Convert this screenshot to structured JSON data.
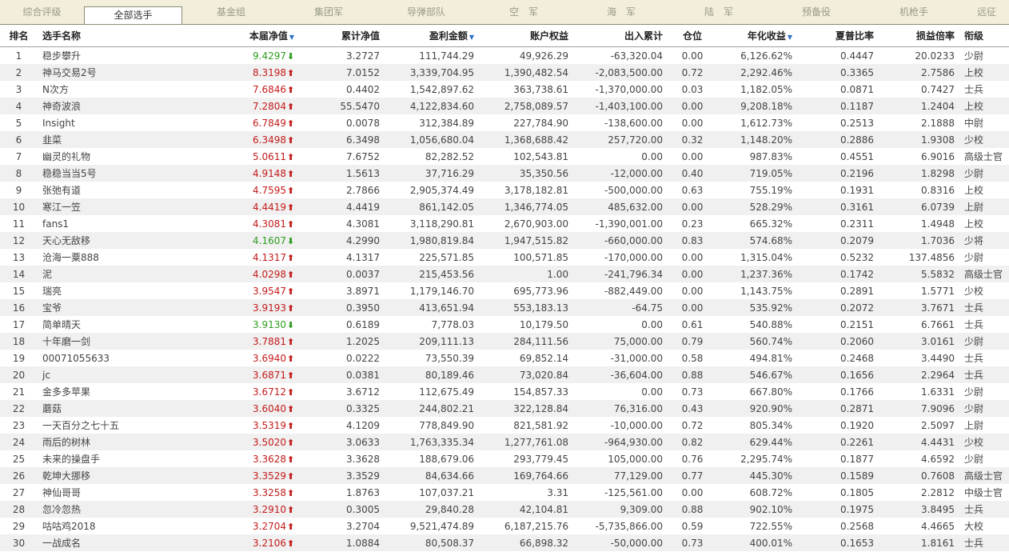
{
  "tabs": [
    "综合评级",
    "全部选手",
    "基金组",
    "集团军",
    "导弹部队",
    "空　军",
    "海　军",
    "陆　军",
    "预备役",
    "机枪手",
    "远征"
  ],
  "active_tab": 1,
  "sort_indicator": "▼",
  "colors": {
    "up": "#c41b1b",
    "down": "#2e9c1f",
    "sort": "#2a6fc9",
    "tab_bar": "#f2eedb",
    "row_alt": "#f0f0f0"
  },
  "icons": {
    "up": "up-arrow-icon",
    "down": "down-arrow-icon"
  },
  "columns": [
    {
      "key": "rank",
      "label": "排名",
      "align": "c"
    },
    {
      "key": "name",
      "label": "选手名称",
      "align": "l"
    },
    {
      "key": "nav",
      "label": "本届净值",
      "align": "r",
      "sorted": true
    },
    {
      "key": "cum",
      "label": "累计净值",
      "align": "r"
    },
    {
      "key": "profit",
      "label": "盈利金额",
      "align": "r",
      "sorted": true
    },
    {
      "key": "equity",
      "label": "账户权益",
      "align": "r"
    },
    {
      "key": "flow",
      "label": "出入累计",
      "align": "r"
    },
    {
      "key": "pos",
      "label": "仓位",
      "align": "c"
    },
    {
      "key": "annual",
      "label": "年化收益",
      "align": "r",
      "sorted": true
    },
    {
      "key": "sharpe",
      "label": "夏普比率",
      "align": "r"
    },
    {
      "key": "ratio",
      "label": "损益倍率",
      "align": "r"
    },
    {
      "key": "rank_title",
      "label": "衔级",
      "align": "l"
    }
  ],
  "rows": [
    {
      "rank": "1",
      "name": "稳步攀升",
      "nav": "9.4297",
      "dir": "down",
      "cum": "3.2727",
      "profit": "111,744.29",
      "equity": "49,926.29",
      "flow": "-63,320.04",
      "pos": "0.00",
      "annual": "6,126.62%",
      "sharpe": "0.4447",
      "ratio": "20.0233",
      "rank_title": "少尉"
    },
    {
      "rank": "2",
      "name": "神马交易2号",
      "nav": "8.3198",
      "dir": "up",
      "cum": "7.0152",
      "profit": "3,339,704.95",
      "equity": "1,390,482.54",
      "flow": "-2,083,500.00",
      "pos": "0.72",
      "annual": "2,292.46%",
      "sharpe": "0.3365",
      "ratio": "2.7586",
      "rank_title": "上校"
    },
    {
      "rank": "3",
      "name": "N次方",
      "nav": "7.6846",
      "dir": "up",
      "cum": "0.4402",
      "profit": "1,542,897.62",
      "equity": "363,738.61",
      "flow": "-1,370,000.00",
      "pos": "0.03",
      "annual": "1,182.05%",
      "sharpe": "0.0871",
      "ratio": "0.7427",
      "rank_title": "士兵"
    },
    {
      "rank": "4",
      "name": "神奇波浪",
      "nav": "7.2804",
      "dir": "up",
      "cum": "55.5470",
      "profit": "4,122,834.60",
      "equity": "2,758,089.57",
      "flow": "-1,403,100.00",
      "pos": "0.00",
      "annual": "9,208.18%",
      "sharpe": "0.1187",
      "ratio": "1.2404",
      "rank_title": "上校"
    },
    {
      "rank": "5",
      "name": "Insight",
      "nav": "6.7849",
      "dir": "up",
      "cum": "0.0078",
      "profit": "312,384.89",
      "equity": "227,784.90",
      "flow": "-138,600.00",
      "pos": "0.00",
      "annual": "1,612.73%",
      "sharpe": "0.2513",
      "ratio": "2.1888",
      "rank_title": "中尉"
    },
    {
      "rank": "6",
      "name": "韭菜",
      "nav": "6.3498",
      "dir": "up",
      "cum": "6.3498",
      "profit": "1,056,680.04",
      "equity": "1,368,688.42",
      "flow": "257,720.00",
      "pos": "0.32",
      "annual": "1,148.20%",
      "sharpe": "0.2886",
      "ratio": "1.9308",
      "rank_title": "少校"
    },
    {
      "rank": "7",
      "name": "幽灵的礼物",
      "nav": "5.0611",
      "dir": "up",
      "cum": "7.6752",
      "profit": "82,282.52",
      "equity": "102,543.81",
      "flow": "0.00",
      "pos": "0.00",
      "annual": "987.83%",
      "sharpe": "0.4551",
      "ratio": "6.9016",
      "rank_title": "高级士官"
    },
    {
      "rank": "8",
      "name": "稳稳当当5号",
      "nav": "4.9148",
      "dir": "up",
      "cum": "1.5613",
      "profit": "37,716.29",
      "equity": "35,350.56",
      "flow": "-12,000.00",
      "pos": "0.40",
      "annual": "719.05%",
      "sharpe": "0.2196",
      "ratio": "1.8298",
      "rank_title": "少尉"
    },
    {
      "rank": "9",
      "name": "张弛有道",
      "nav": "4.7595",
      "dir": "up",
      "cum": "2.7866",
      "profit": "2,905,374.49",
      "equity": "3,178,182.81",
      "flow": "-500,000.00",
      "pos": "0.63",
      "annual": "755.19%",
      "sharpe": "0.1931",
      "ratio": "0.8316",
      "rank_title": "上校"
    },
    {
      "rank": "10",
      "name": "寒江一笠",
      "nav": "4.4419",
      "dir": "up",
      "cum": "4.4419",
      "profit": "861,142.05",
      "equity": "1,346,774.05",
      "flow": "485,632.00",
      "pos": "0.00",
      "annual": "528.29%",
      "sharpe": "0.3161",
      "ratio": "6.0739",
      "rank_title": "上尉"
    },
    {
      "rank": "11",
      "name": "fans1",
      "nav": "4.3081",
      "dir": "up",
      "cum": "4.3081",
      "profit": "3,118,290.81",
      "equity": "2,670,903.00",
      "flow": "-1,390,001.00",
      "pos": "0.23",
      "annual": "665.32%",
      "sharpe": "0.2311",
      "ratio": "1.4948",
      "rank_title": "上校"
    },
    {
      "rank": "12",
      "name": "天心无敌移",
      "nav": "4.1607",
      "dir": "down",
      "cum": "4.2990",
      "profit": "1,980,819.84",
      "equity": "1,947,515.82",
      "flow": "-660,000.00",
      "pos": "0.83",
      "annual": "574.68%",
      "sharpe": "0.2079",
      "ratio": "1.7036",
      "rank_title": "少将"
    },
    {
      "rank": "13",
      "name": "沧海一粟888",
      "nav": "4.1317",
      "dir": "up",
      "cum": "4.1317",
      "profit": "225,571.85",
      "equity": "100,571.85",
      "flow": "-170,000.00",
      "pos": "0.00",
      "annual": "1,315.04%",
      "sharpe": "0.5232",
      "ratio": "137.4856",
      "rank_title": "少尉"
    },
    {
      "rank": "14",
      "name": "泥",
      "nav": "4.0298",
      "dir": "up",
      "cum": "0.0037",
      "profit": "215,453.56",
      "equity": "1.00",
      "flow": "-241,796.34",
      "pos": "0.00",
      "annual": "1,237.36%",
      "sharpe": "0.1742",
      "ratio": "5.5832",
      "rank_title": "高级士官"
    },
    {
      "rank": "15",
      "name": "瑞亮",
      "nav": "3.9547",
      "dir": "up",
      "cum": "3.8971",
      "profit": "1,179,146.70",
      "equity": "695,773.96",
      "flow": "-882,449.00",
      "pos": "0.00",
      "annual": "1,143.75%",
      "sharpe": "0.2891",
      "ratio": "1.5771",
      "rank_title": "少校"
    },
    {
      "rank": "16",
      "name": "宝爷",
      "nav": "3.9193",
      "dir": "up",
      "cum": "0.3950",
      "profit": "413,651.94",
      "equity": "553,183.13",
      "flow": "-64.75",
      "pos": "0.00",
      "annual": "535.92%",
      "sharpe": "0.2072",
      "ratio": "3.7671",
      "rank_title": "士兵"
    },
    {
      "rank": "17",
      "name": "简单晴天",
      "nav": "3.9130",
      "dir": "down",
      "cum": "0.6189",
      "profit": "7,778.03",
      "equity": "10,179.50",
      "flow": "0.00",
      "pos": "0.61",
      "annual": "540.88%",
      "sharpe": "0.2151",
      "ratio": "6.7661",
      "rank_title": "士兵"
    },
    {
      "rank": "18",
      "name": "十年磨一剑",
      "nav": "3.7881",
      "dir": "up",
      "cum": "1.2025",
      "profit": "209,111.13",
      "equity": "284,111.56",
      "flow": "75,000.00",
      "pos": "0.79",
      "annual": "560.74%",
      "sharpe": "0.2060",
      "ratio": "3.0161",
      "rank_title": "少尉"
    },
    {
      "rank": "19",
      "name": "00071055633",
      "nav": "3.6940",
      "dir": "up",
      "cum": "0.0222",
      "profit": "73,550.39",
      "equity": "69,852.14",
      "flow": "-31,000.00",
      "pos": "0.58",
      "annual": "494.81%",
      "sharpe": "0.2468",
      "ratio": "3.4490",
      "rank_title": "士兵"
    },
    {
      "rank": "20",
      "name": "jc",
      "nav": "3.6871",
      "dir": "up",
      "cum": "0.0381",
      "profit": "80,189.46",
      "equity": "73,020.84",
      "flow": "-36,604.00",
      "pos": "0.88",
      "annual": "546.67%",
      "sharpe": "0.1656",
      "ratio": "2.2964",
      "rank_title": "士兵"
    },
    {
      "rank": "21",
      "name": "金多多苹果",
      "nav": "3.6712",
      "dir": "up",
      "cum": "3.6712",
      "profit": "112,675.49",
      "equity": "154,857.33",
      "flow": "0.00",
      "pos": "0.73",
      "annual": "667.80%",
      "sharpe": "0.1766",
      "ratio": "1.6331",
      "rank_title": "少尉"
    },
    {
      "rank": "22",
      "name": "蘑菇",
      "nav": "3.6040",
      "dir": "up",
      "cum": "0.3325",
      "profit": "244,802.21",
      "equity": "322,128.84",
      "flow": "76,316.00",
      "pos": "0.43",
      "annual": "920.90%",
      "sharpe": "0.2871",
      "ratio": "7.9096",
      "rank_title": "少尉"
    },
    {
      "rank": "23",
      "name": "一天百分之七十五",
      "nav": "3.5319",
      "dir": "up",
      "cum": "4.1209",
      "profit": "778,849.90",
      "equity": "821,581.92",
      "flow": "-10,000.00",
      "pos": "0.72",
      "annual": "805.34%",
      "sharpe": "0.1920",
      "ratio": "2.5097",
      "rank_title": "上尉"
    },
    {
      "rank": "24",
      "name": "雨后的树林",
      "nav": "3.5020",
      "dir": "up",
      "cum": "3.0633",
      "profit": "1,763,335.34",
      "equity": "1,277,761.08",
      "flow": "-964,930.00",
      "pos": "0.82",
      "annual": "629.44%",
      "sharpe": "0.2261",
      "ratio": "4.4431",
      "rank_title": "少校"
    },
    {
      "rank": "25",
      "name": "未来的操盘手",
      "nav": "3.3628",
      "dir": "up",
      "cum": "3.3628",
      "profit": "188,679.06",
      "equity": "293,779.45",
      "flow": "105,000.00",
      "pos": "0.76",
      "annual": "2,295.74%",
      "sharpe": "0.1877",
      "ratio": "4.6592",
      "rank_title": "少尉"
    },
    {
      "rank": "26",
      "name": "乾坤大挪移",
      "nav": "3.3529",
      "dir": "up",
      "cum": "3.3529",
      "profit": "84,634.66",
      "equity": "169,764.66",
      "flow": "77,129.00",
      "pos": "0.77",
      "annual": "445.30%",
      "sharpe": "0.1589",
      "ratio": "0.7608",
      "rank_title": "高级士官"
    },
    {
      "rank": "27",
      "name": "神仙哥哥",
      "nav": "3.3258",
      "dir": "up",
      "cum": "1.8763",
      "profit": "107,037.21",
      "equity": "3.31",
      "flow": "-125,561.00",
      "pos": "0.00",
      "annual": "608.72%",
      "sharpe": "0.1805",
      "ratio": "2.2812",
      "rank_title": "中级士官"
    },
    {
      "rank": "28",
      "name": "忽冷忽热",
      "nav": "3.2910",
      "dir": "up",
      "cum": "0.3005",
      "profit": "29,840.28",
      "equity": "42,104.81",
      "flow": "9,309.00",
      "pos": "0.88",
      "annual": "902.10%",
      "sharpe": "0.1975",
      "ratio": "3.8495",
      "rank_title": "士兵"
    },
    {
      "rank": "29",
      "name": "咕咕鸡2018",
      "nav": "3.2704",
      "dir": "up",
      "cum": "3.2704",
      "profit": "9,521,474.89",
      "equity": "6,187,215.76",
      "flow": "-5,735,866.00",
      "pos": "0.59",
      "annual": "722.55%",
      "sharpe": "0.2568",
      "ratio": "4.4665",
      "rank_title": "大校"
    },
    {
      "rank": "30",
      "name": "一战成名",
      "nav": "3.2106",
      "dir": "up",
      "cum": "1.0884",
      "profit": "80,508.37",
      "equity": "66,898.32",
      "flow": "-50,000.00",
      "pos": "0.73",
      "annual": "400.01%",
      "sharpe": "0.1653",
      "ratio": "1.8161",
      "rank_title": "士兵"
    }
  ]
}
